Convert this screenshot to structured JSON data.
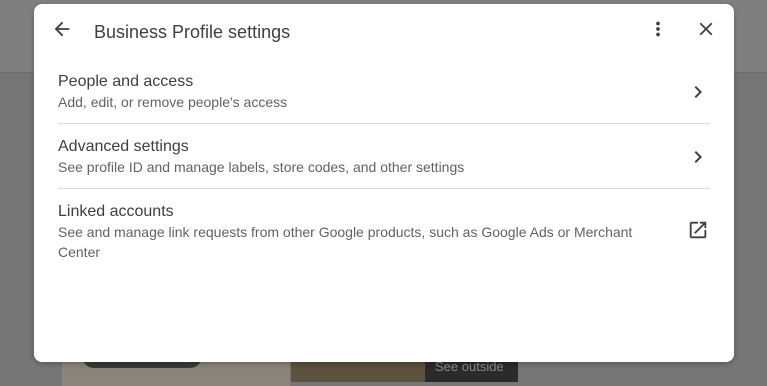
{
  "background": {
    "see_outside_label": "See outside"
  },
  "dialog": {
    "title": "Business Profile settings",
    "icons": {
      "back": "arrow-back-icon",
      "more": "more-vert-icon",
      "close": "close-icon"
    },
    "items": [
      {
        "label": "People and access",
        "description": "Add, edit, or remove people's access",
        "trailing_icon": "chevron-right-icon"
      },
      {
        "label": "Advanced settings",
        "description": "See profile ID and manage labels, store codes, and other settings",
        "trailing_icon": "chevron-right-icon"
      },
      {
        "label": "Linked accounts",
        "description": "See and manage link requests from other Google products, such as Google Ads or Merchant Center",
        "trailing_icon": "open-in-new-icon"
      }
    ]
  },
  "colors": {
    "text_primary": "#3c4043",
    "text_secondary": "#5f6368",
    "divider": "#dadce0",
    "scrim": "#767676"
  }
}
